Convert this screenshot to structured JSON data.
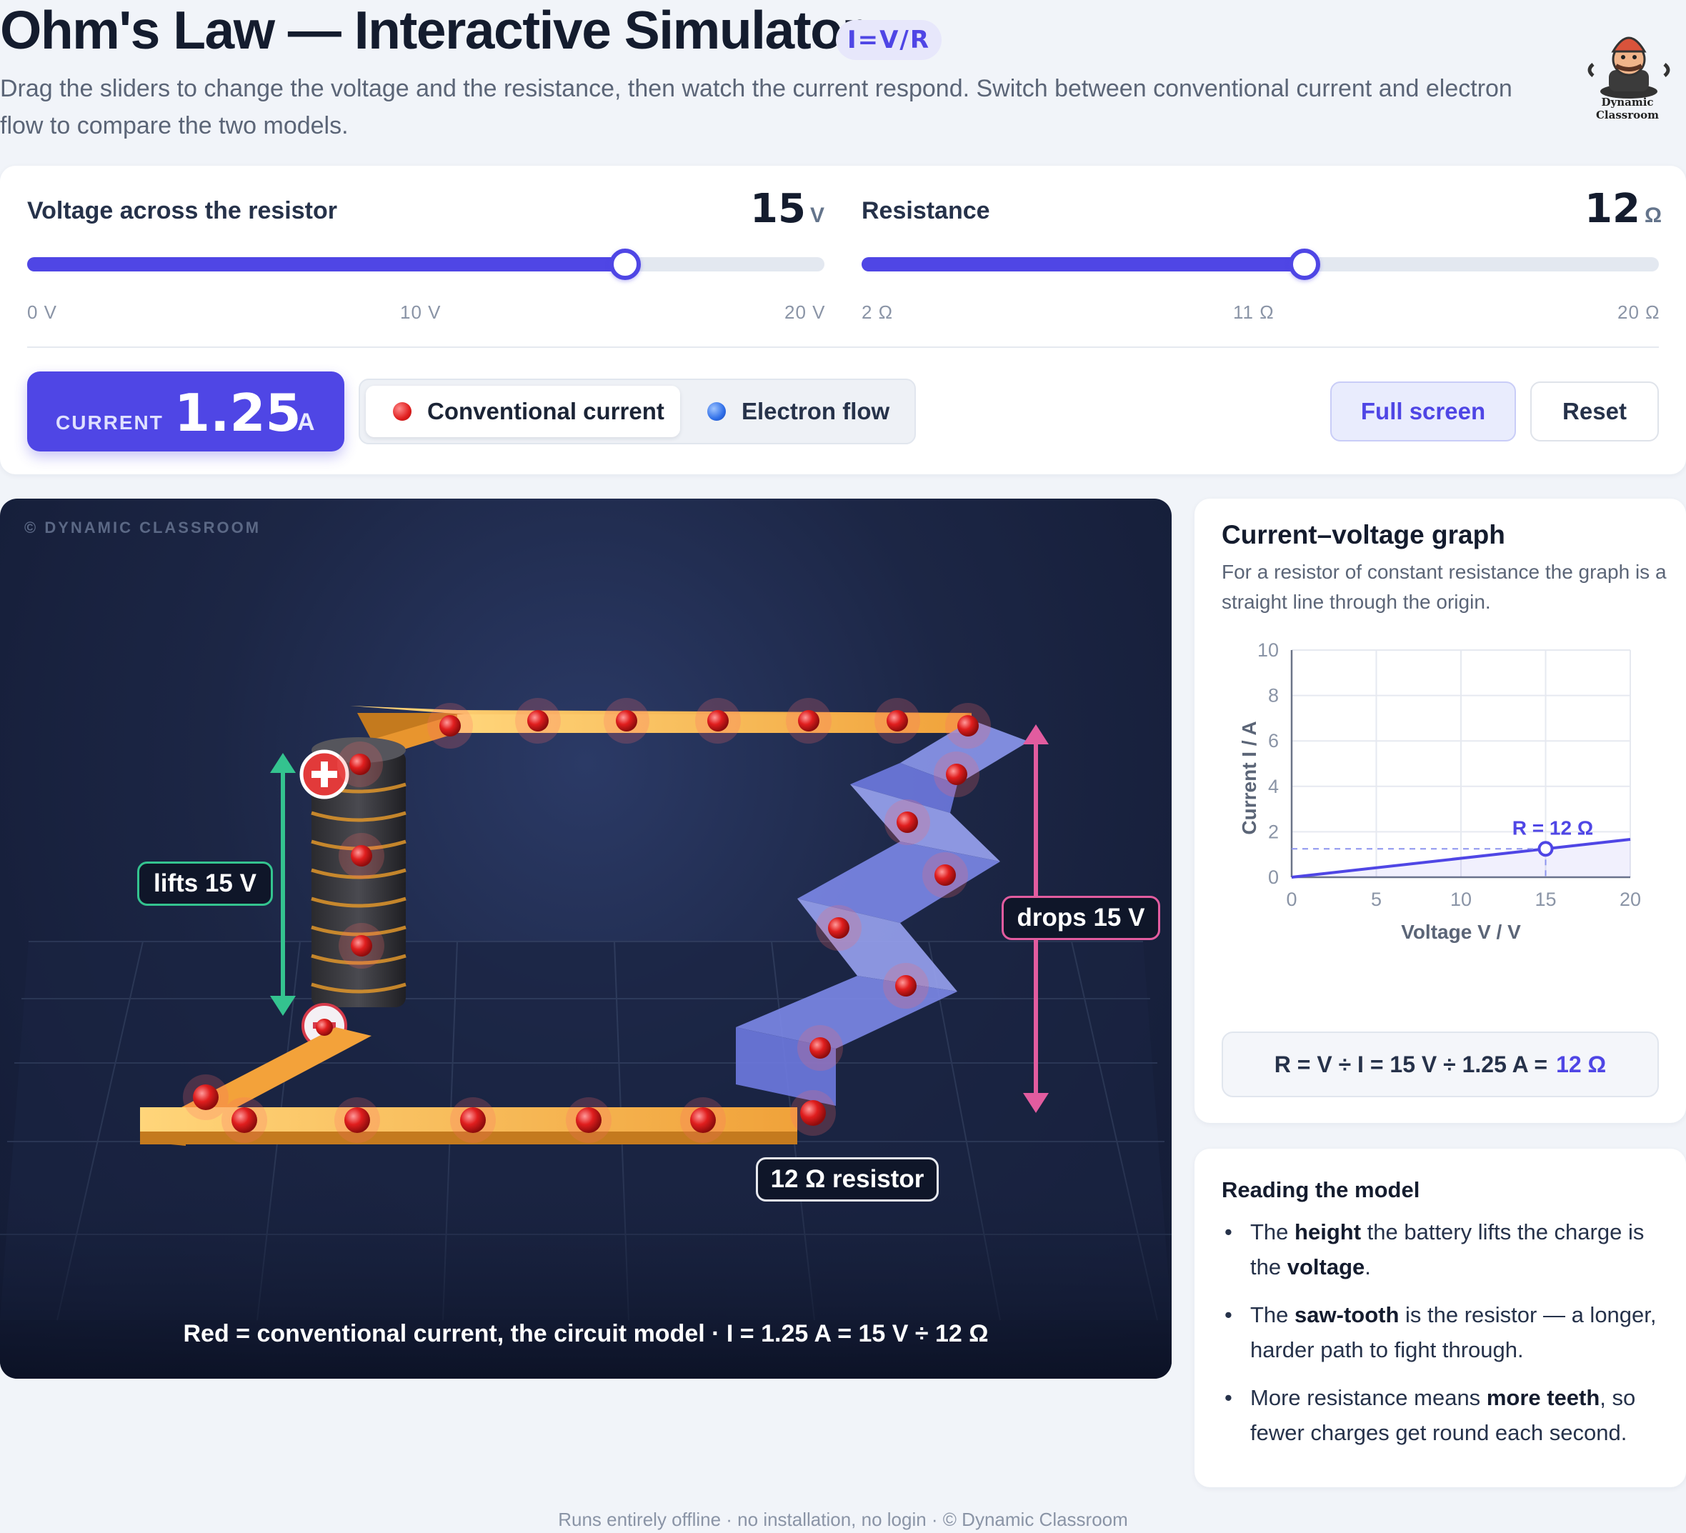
{
  "header": {
    "title": "Ohm's Law — Interactive Simulator",
    "formula_badge": "I=V/R",
    "subtitle": "Drag the sliders to change the voltage and the resistance, then watch the current respond. Switch between conventional current and electron flow to compare the two models.",
    "logo_text": "Dynamic Classroom"
  },
  "controls": {
    "voltage": {
      "label": "Voltage across the resistor",
      "value": "15",
      "unit": "V",
      "min": 0,
      "max": 20,
      "current": 15,
      "ticks": [
        "0 V",
        "10 V",
        "20 V"
      ]
    },
    "resistance": {
      "label": "Resistance",
      "value": "12",
      "unit": "Ω",
      "min": 2,
      "max": 20,
      "current": 12,
      "ticks": [
        "2 Ω",
        "11 Ω",
        "20 Ω"
      ]
    },
    "current": {
      "label": "CURRENT",
      "value": "1.25",
      "unit": "A"
    },
    "modes": {
      "conventional": "Conventional current",
      "electron": "Electron flow",
      "selected": "conventional"
    },
    "fullscreen_label": "Full screen",
    "reset_label": "Reset"
  },
  "scene": {
    "watermark": "© DYNAMIC CLASSROOM",
    "lift_label": "lifts 15 V",
    "drop_label": "drops 15 V",
    "resistor_label": "12 Ω resistor",
    "caption": "Red = conventional current, the circuit model  ·  I = 1.25 A = 15 V ÷ 12 Ω",
    "colors": {
      "wire": "#f2a63a",
      "resistor": "#8c98ee",
      "charge": "#e01e1e",
      "lift": "#34c38f",
      "drop": "#e25c9f"
    }
  },
  "graph": {
    "title": "Current–voltage graph",
    "description": "For a resistor of constant resistance the graph is a straight line through the origin.",
    "formula": "R = V ÷ I = 15 V ÷ 1.25 A =",
    "formula_result": "12 Ω"
  },
  "chart_data": {
    "type": "line",
    "xlabel": "Voltage V / V",
    "ylabel": "Current I / A",
    "xlim": [
      0,
      20
    ],
    "ylim": [
      0,
      10
    ],
    "xticks": [
      0,
      5,
      10,
      15,
      20
    ],
    "yticks": [
      0,
      2,
      4,
      6,
      8,
      10
    ],
    "grid": true,
    "series": [
      {
        "x": [
          0,
          20
        ],
        "y": [
          0,
          1.667
        ]
      }
    ],
    "marker": {
      "x": 15,
      "y": 1.25,
      "label": "R = 12 Ω"
    }
  },
  "reading": {
    "title": "Reading the model",
    "items": [
      {
        "parts": [
          [
            "The ",
            false
          ],
          [
            "height",
            true
          ],
          [
            " the battery lifts the charge is the ",
            false
          ],
          [
            "voltage",
            true
          ],
          [
            ".",
            false
          ]
        ]
      },
      {
        "parts": [
          [
            "The ",
            false
          ],
          [
            "saw-tooth",
            true
          ],
          [
            " is the resistor — a longer, harder path to fight through.",
            false
          ]
        ]
      },
      {
        "parts": [
          [
            "More resistance means ",
            false
          ],
          [
            "more teeth",
            true
          ],
          [
            ", so fewer charges get round each second.",
            false
          ]
        ]
      }
    ]
  },
  "footer": "Runs entirely offline · no installation, no login · © Dynamic Classroom"
}
